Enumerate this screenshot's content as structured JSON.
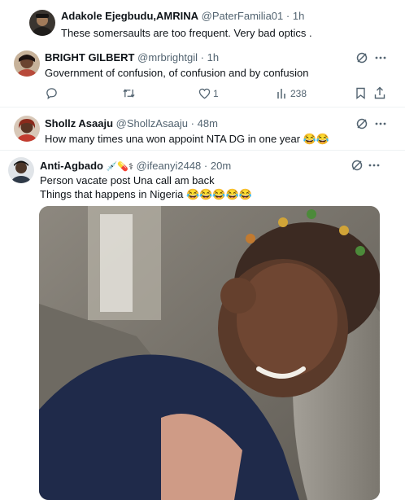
{
  "tweets": [
    {
      "name": "Adakole Ejegbudu,AMRINA",
      "handle": "@PaterFamilia01",
      "time": "1h",
      "text": "These somersaults are too frequent. Very bad optics ."
    },
    {
      "name": "BRIGHT GILBERT",
      "handle": "@mrbrightgil",
      "time": "1h",
      "text": "Government of confusion, of confusion and by confusion",
      "actions": {
        "likes": "1",
        "views": "238"
      }
    },
    {
      "name": "Shollz Asaaju",
      "handle": "@ShollzAsaaju",
      "time": "48m",
      "text": "How many times una won appoint NTA DG in one year",
      "emoji": "😂😂"
    },
    {
      "name": "Anti-Agbado",
      "name_emoji": "💉💊⚕",
      "handle": "@ifeanyi2448",
      "time": "20m",
      "text_line1": "Person vacate post Una call am back",
      "text_line2": "Things that happens in Nigeria",
      "emoji": "😂😂😂😂😂"
    }
  ],
  "separator": "·",
  "icons": {
    "grok": "grok-icon",
    "more": "more-icon",
    "reply": "reply-icon",
    "retweet": "retweet-icon",
    "like": "like-icon",
    "views": "views-icon",
    "bookmark": "bookmark-icon",
    "share": "share-icon"
  },
  "colors": {
    "text": "#0f1419",
    "muted": "#536471",
    "divider": "#eff3f4",
    "accent": "#1d9bf0"
  }
}
